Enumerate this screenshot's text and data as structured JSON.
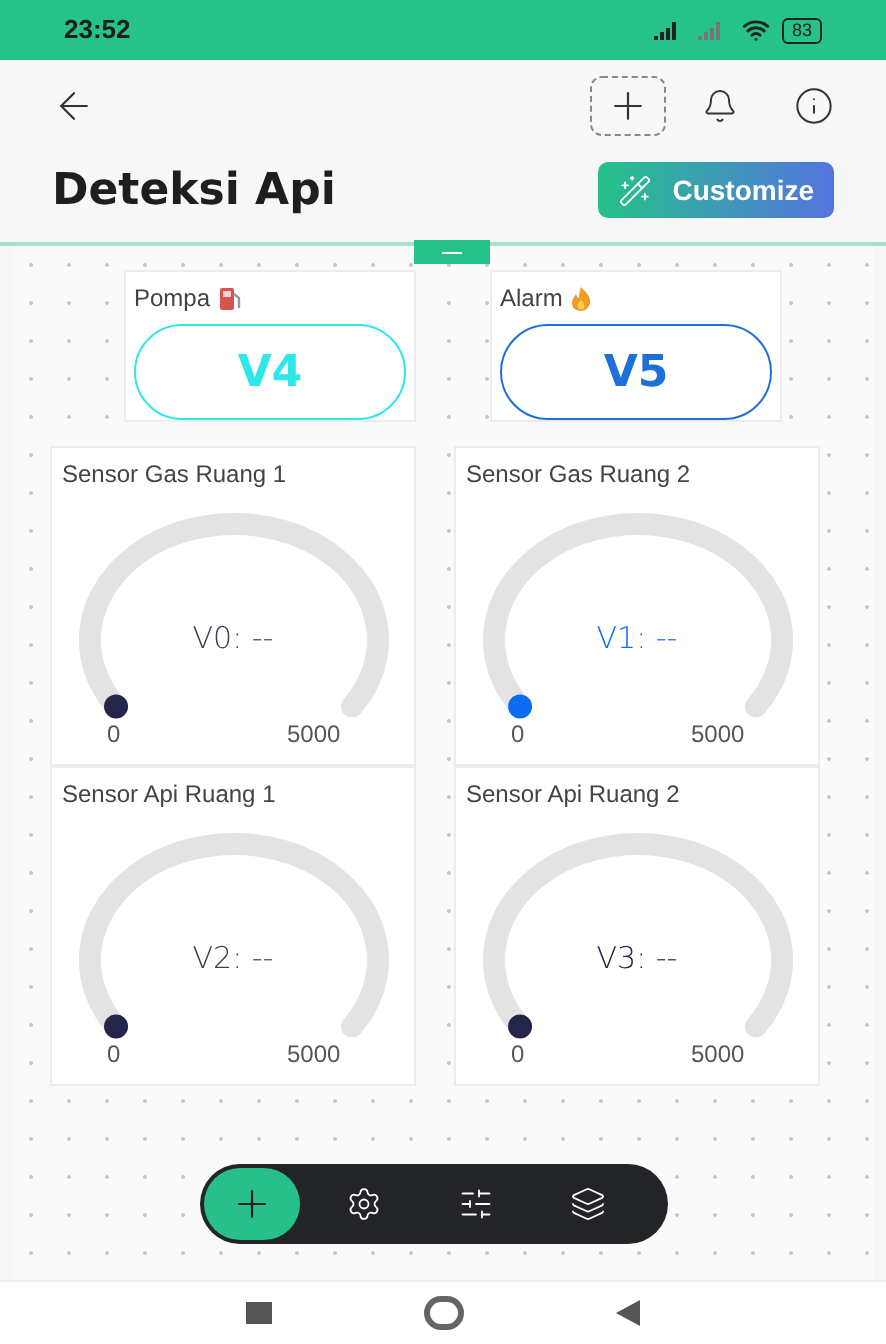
{
  "status_bar": {
    "time": "23:52",
    "battery": "83"
  },
  "header": {
    "title": "Deteksi Api",
    "customize_button": "Customize"
  },
  "switches": [
    {
      "label": "Pompa",
      "kind": "fuel",
      "pin": "V4",
      "color": "#2ee8e8"
    },
    {
      "label": "Alarm",
      "kind": "flame",
      "pin": "V5",
      "color": "#1f6fd8"
    }
  ],
  "gauges": [
    {
      "title": "Sensor Gas Ruang 1",
      "value": "V0: --",
      "min": "0",
      "max": "5000",
      "color": "#23254a"
    },
    {
      "title": "Sensor Gas Ruang 2",
      "value": "V1: --",
      "min": "0",
      "max": "5000",
      "color": "#0a6cf0"
    },
    {
      "title": "Sensor Api Ruang 1",
      "value": "V2: --",
      "min": "0",
      "max": "5000",
      "color": "#23254a"
    },
    {
      "title": "Sensor Api Ruang 2",
      "value": "V3: --",
      "min": "0",
      "max": "5000",
      "color": "#23254a"
    }
  ],
  "toolbar": [
    {
      "kind": "add",
      "selected": true
    },
    {
      "kind": "settings",
      "selected": false
    },
    {
      "kind": "datastreams",
      "selected": false
    },
    {
      "kind": "layers",
      "selected": false
    }
  ]
}
